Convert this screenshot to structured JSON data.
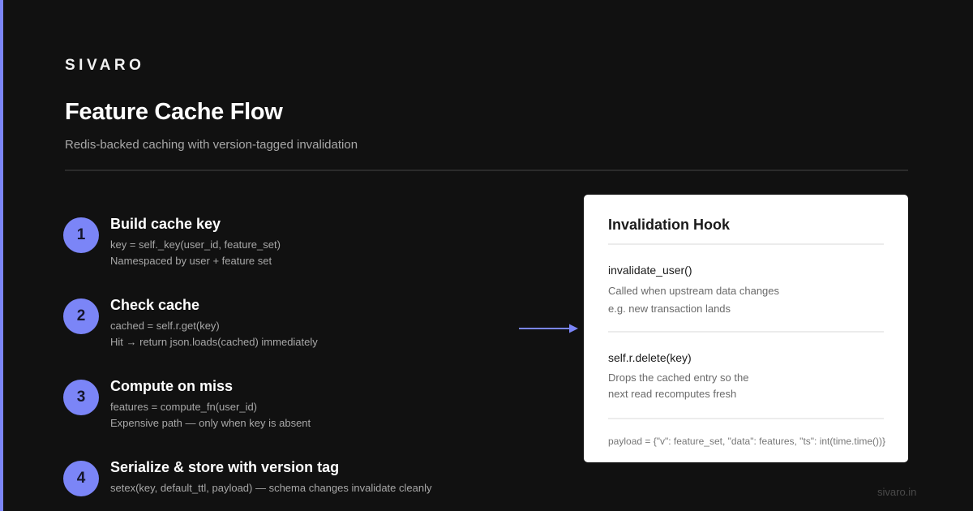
{
  "brand": "SIVARO",
  "header": {
    "title": "Feature Cache Flow",
    "subtitle": "Redis-backed caching with version-tagged invalidation"
  },
  "steps": [
    {
      "number": "1",
      "title": "Build cache key",
      "line1": "key = self._key(user_id, feature_set)",
      "line2": "Namespaced by user + feature set"
    },
    {
      "number": "2",
      "title": "Check cache",
      "line1": "cached = self.r.get(key)",
      "line2": "Hit → return json.loads(cached) immediately"
    },
    {
      "number": "3",
      "title": "Compute on miss",
      "line1": "features = compute_fn(user_id)",
      "line2": "Expensive path — only when key is absent"
    },
    {
      "number": "4",
      "title": "Serialize & store with version tag",
      "line1": "setex(key, default_ttl, payload) — schema changes invalidate cleanly",
      "line2": ""
    }
  ],
  "card": {
    "title": "Invalidation Hook",
    "sections": [
      {
        "heading": "invalidate_user()",
        "line1": "Called when upstream data changes",
        "line2": "e.g. new transaction lands"
      },
      {
        "heading": "self.r.delete(key)",
        "line1": "Drops the cached entry so the",
        "line2": "next read recomputes fresh"
      }
    ],
    "footer": "payload = {\"v\": feature_set, \"data\": features, \"ts\": int(time.time())}"
  },
  "footer_url": "sivaro.in",
  "colors": {
    "background": "#111111",
    "accent": "#7b85f7",
    "card": "#ffffff"
  },
  "icons": {
    "connector": "arrow-right-icon"
  }
}
